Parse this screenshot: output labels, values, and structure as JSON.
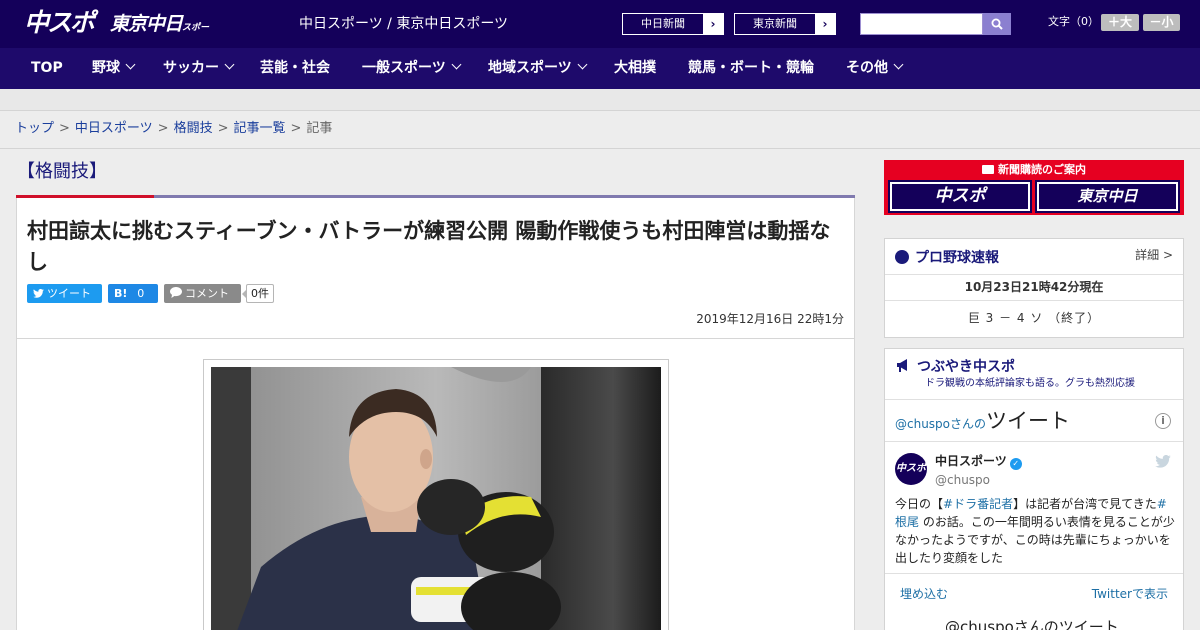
{
  "header": {
    "site_names": "中日スポーツ / 東京中日スポーツ",
    "logo_chuspo": "中スポ",
    "logo_tokyo": "東京中日",
    "logo_tokyo_small": "スポーツ",
    "ext_links": [
      "中日新聞",
      "東京新聞"
    ],
    "search_placeholder": "",
    "fontsize_label": "文字（0）",
    "font_larger": "＋大",
    "font_smaller": "－小"
  },
  "nav": {
    "items": [
      "TOP",
      "野球",
      "サッカー",
      "芸能・社会",
      "一般スポーツ",
      "地域スポーツ",
      "大相撲",
      "競馬・ボート・競輪",
      "その他"
    ]
  },
  "breadcrumb": {
    "items": [
      "トップ",
      "中日スポーツ",
      "格闘技",
      "記事一覧"
    ],
    "current": "記事"
  },
  "article": {
    "category": "【格闘技】",
    "headline": "村田諒太に挑むスティーブン・バトラーが練習公開 陽動作戦使うも村田陣営は動揺なし",
    "share": {
      "tweet_label": "ツイート",
      "hatena_label": "B!",
      "hatena_count": "0",
      "comment_label": "コメント",
      "comment_count": "0件"
    },
    "date": "2019年12月16日 22時1分"
  },
  "sidebar": {
    "subscription": {
      "title": "新聞購読のご案内",
      "logos": [
        "中スポ",
        "東京中日"
      ]
    },
    "baseball": {
      "title": "プロ野球速報",
      "more": "詳細 >",
      "time": "10月23日21時42分現在",
      "score": "巨 3 － 4 ソ （終了）"
    },
    "tsubuyaki": {
      "title": "つぶやき中スポ",
      "subtitle": "ドラ観戦の本紙評論家も語る。グラも熱烈応援",
      "tweets_head_handle": "@chuspoさんの",
      "tweets_head_big": "ツイート",
      "account_name": "中日スポーツ",
      "account_handle": "@chuspo",
      "avatar_text": "中スポ",
      "tweet_pre": "今日の【",
      "tweet_tag1": "#ドラ番記者",
      "tweet_mid": "】は記者が台湾で見てきた",
      "tweet_tag2": "#根尾",
      "tweet_post": " のお話。この一年間明るい表情を見ることが少なかったようですが、この時は先輩にちょっかいを出したり変顔をした",
      "embed": "埋め込む",
      "view_on_twitter": "Twitterで表示",
      "next_head": "@chuspoさんのツイート"
    }
  },
  "colors": {
    "header_bg": "#14005a",
    "nav_bg": "#1e0a6b",
    "accent_red": "#d0102a",
    "link_blue": "#1a3e9c"
  }
}
